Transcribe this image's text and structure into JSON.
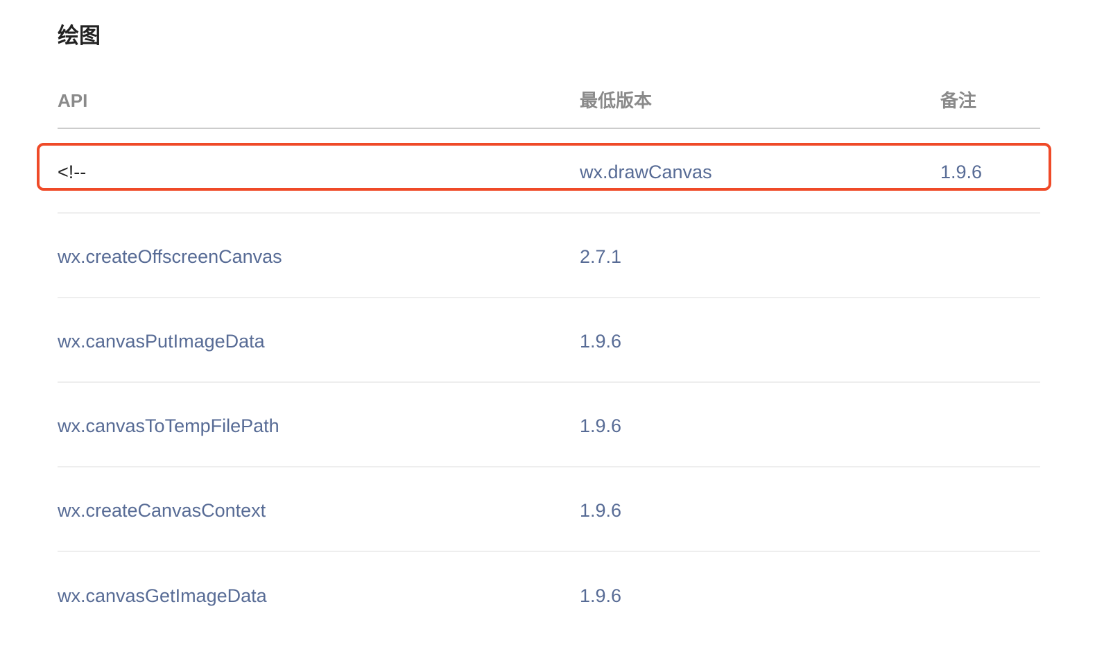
{
  "section": {
    "title": "绘图"
  },
  "table": {
    "headers": {
      "api": "API",
      "min_version": "最低版本",
      "note": "备注"
    },
    "rows": [
      {
        "api": "<!--",
        "min_version": "wx.drawCanvas",
        "note": "1.9.6"
      },
      {
        "api": "wx.createOffscreenCanvas",
        "min_version": "2.7.1"
      },
      {
        "api": "wx.canvasPutImageData",
        "min_version": "1.9.6"
      },
      {
        "api": "wx.canvasToTempFilePath",
        "min_version": "1.9.6"
      },
      {
        "api": "wx.createCanvasContext",
        "min_version": "1.9.6"
      },
      {
        "api": "wx.canvasGetImageData",
        "min_version": "1.9.6"
      }
    ]
  },
  "colors": {
    "text": "#222222",
    "header_text": "#8a8a8a",
    "link": "#576b95",
    "highlight": "#ef4a28",
    "header_border": "#cccccc",
    "row_border": "#eeeeee"
  }
}
